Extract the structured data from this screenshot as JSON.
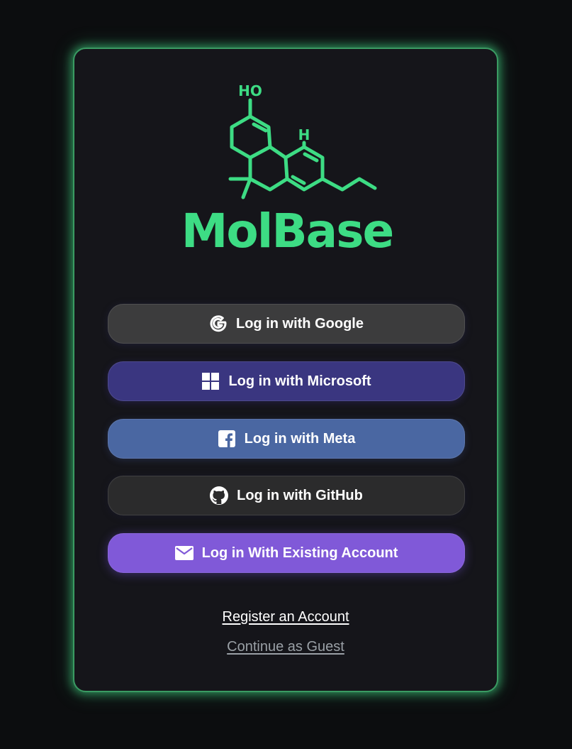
{
  "brand": {
    "name": "MolBase",
    "molecule_labels": {
      "hydroxyl": "HO",
      "hydrogen": "H"
    },
    "accent_color": "#3ddc84"
  },
  "auth": {
    "buttons": [
      {
        "label": "Log in with Google",
        "icon": "google-icon",
        "color": "#3c3c3d"
      },
      {
        "label": "Log in with Microsoft",
        "icon": "microsoft-icon",
        "color": "#3a3680"
      },
      {
        "label": "Log in with Meta",
        "icon": "facebook-icon",
        "color": "#4a67a2"
      },
      {
        "label": "Log in with GitHub",
        "icon": "github-icon",
        "color": "#2b2b2c"
      },
      {
        "label": "Log in With Existing Account",
        "icon": "mail-icon",
        "color": "#8059d8"
      }
    ],
    "register_link": "Register an Account",
    "guest_link": "Continue as Guest"
  }
}
